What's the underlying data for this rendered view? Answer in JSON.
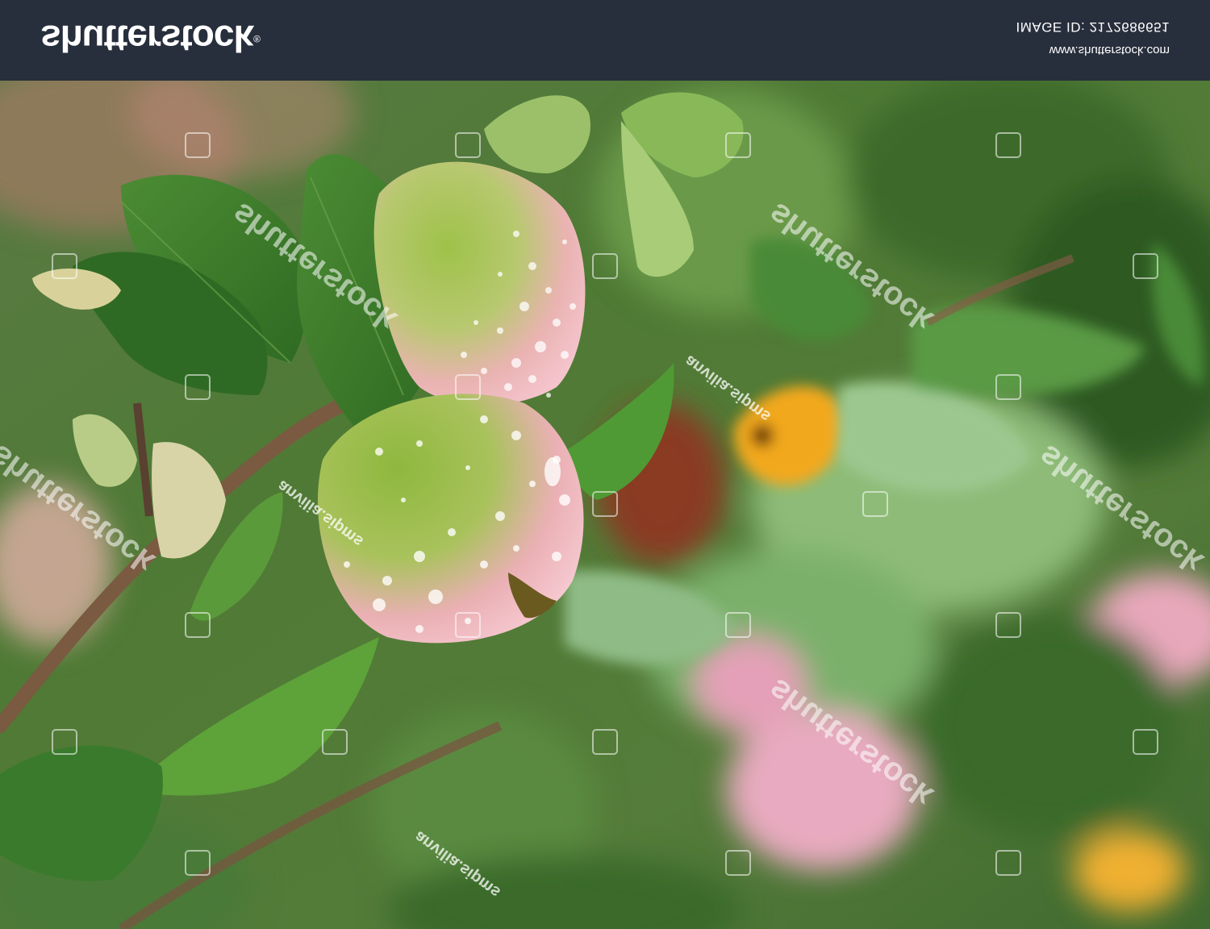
{
  "header": {
    "logo_text": "shutterstock",
    "logo_reg": "®",
    "url": "www.shutterstock.com",
    "image_id": "IMAGE ID: 2172686651"
  },
  "watermark": {
    "brand": "shutterstock",
    "credit": "anvilia.sipms"
  },
  "colors": {
    "header_bg": "#272e3c",
    "leaf_green": "#3e7a2c",
    "apple_green": "#8cb83a",
    "apple_pink": "#f2bcc4",
    "flower_orange": "#f0a020"
  },
  "icons": [
    "shutterstock-logo",
    "watermark-icon"
  ]
}
